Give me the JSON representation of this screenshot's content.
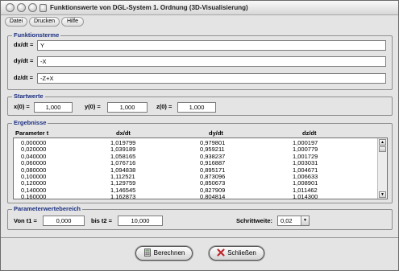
{
  "window": {
    "title": "Funktionswerte von DGL-System 1. Ordnung (3D-Visualisierung)",
    "title_buttons": [
      "close",
      "minimize",
      "zoom"
    ]
  },
  "menu": [
    "Datei",
    "Drucken",
    "Hilfe"
  ],
  "funktionsterme": {
    "title": "Funktionsterme",
    "fields": [
      {
        "label": "dx/dt =",
        "value": "Y"
      },
      {
        "label": "dy/dt =",
        "value": "-X"
      },
      {
        "label": "dz/dt =",
        "value": "-Z+X"
      }
    ]
  },
  "startwerte": {
    "title": "Startwerte",
    "fields": [
      {
        "label": "x(0) =",
        "value": "1,000"
      },
      {
        "label": "y(0) =",
        "value": "1,000"
      },
      {
        "label": "z(0) =",
        "value": "1,000"
      }
    ]
  },
  "ergebnisse": {
    "title": "Ergebnisse",
    "columns": [
      "Parameter t",
      "dx/dt",
      "dy/dt",
      "dz/dt"
    ],
    "rows": [
      [
        "0,000000",
        "1,019799",
        "0,979801",
        "1,000197"
      ],
      [
        "0,020000",
        "1,039189",
        "0,959211",
        "1,000779"
      ],
      [
        "0,040000",
        "1,058165",
        "0,938237",
        "1,001729"
      ],
      [
        "0,060000",
        "1,076716",
        "0,916887",
        "1,003031"
      ],
      [
        "0,080000",
        "1,094838",
        "0,895171",
        "1,004671"
      ],
      [
        "0,100000",
        "1,112521",
        "0,873096",
        "1,006633"
      ],
      [
        "0,120000",
        "1,129759",
        "0,850673",
        "1,008901"
      ],
      [
        "0,140000",
        "1,146545",
        "0,827909",
        "1,011462"
      ],
      [
        "0,160000",
        "1,162873",
        "0,804814",
        "1,014300"
      ]
    ]
  },
  "parameterwertebereich": {
    "title": "Parameterwertebereich",
    "von_label": "Von t1 =",
    "von_value": "0,000",
    "bis_label": "bis t2 =",
    "bis_value": "10,000",
    "schritt_label": "Schrittweite:",
    "schritt_value": "0,02"
  },
  "buttons": {
    "berechnen": "Berechnen",
    "schliessen": "Schließen"
  },
  "colors": {
    "group_title": "#1a2e80",
    "window_bg": "#e4e4e4",
    "close_icon": "#c0282d"
  }
}
